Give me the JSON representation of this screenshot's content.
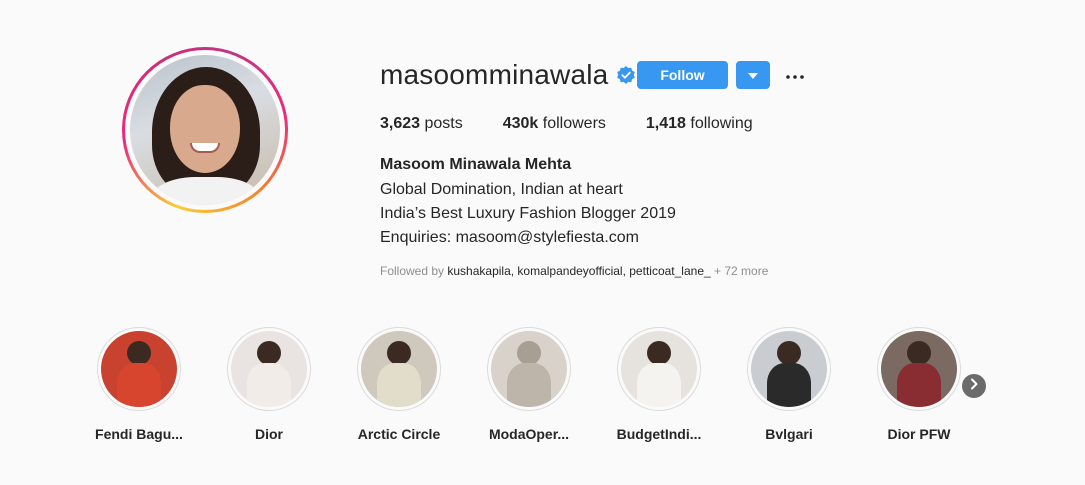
{
  "profile": {
    "username": "masoomminawala",
    "follow_label": "Follow",
    "full_name": "Masoom Minawala Mehta",
    "bio": [
      "Global Domination, Indian at heart",
      "India’s Best Luxury Fashion Blogger 2019",
      "Enquiries: masoom@stylefiesta.com"
    ],
    "followed_by_prefix": "Followed by ",
    "followed_by_names": "kushakapila, komalpandeyofficial, petticoat_lane_",
    "followed_by_more": " + 72 more"
  },
  "stats": {
    "posts_count": "3,623",
    "posts_label": " posts",
    "followers_count": "430k",
    "followers_label": " followers",
    "following_count": "1,418",
    "following_label": " following"
  },
  "highlights": [
    {
      "label": "Fendi Bagu...",
      "bg": "#c9412f",
      "body": "#d8452e"
    },
    {
      "label": "Dior",
      "bg": "#e9e4e2",
      "body": "#f2ece8"
    },
    {
      "label": "Arctic Circle",
      "bg": "#cfc9bd",
      "body": "#e2dccb"
    },
    {
      "label": "ModaOper...",
      "bg": "#d8d2cb",
      "body": "#bdb5aa"
    },
    {
      "label": "BudgetIndi...",
      "bg": "#e6e3df",
      "body": "#f5f3f0"
    },
    {
      "label": "Bvlgari",
      "bg": "#c9ccd0",
      "body": "#2a2a2a"
    },
    {
      "label": "Dior PFW",
      "bg": "#7a6a62",
      "body": "#8a2d33"
    }
  ],
  "colors": {
    "accent": "#3897f0",
    "text": "#262626",
    "muted": "#8e8e8e",
    "background": "#fafafa"
  },
  "icons": {
    "verified": "verified-badge-icon",
    "dropdown": "caret-down-icon",
    "more": "more-dots-icon",
    "next": "chevron-right-icon"
  }
}
